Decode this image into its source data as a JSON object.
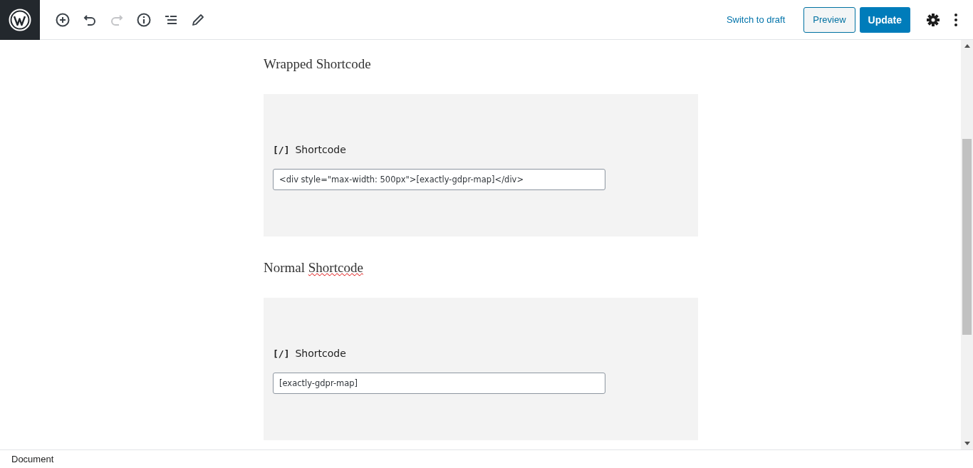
{
  "toolbar": {
    "tools": [
      {
        "kind": "add",
        "disabled": false
      },
      {
        "kind": "undo",
        "disabled": false
      },
      {
        "kind": "redo",
        "disabled": true
      },
      {
        "kind": "info",
        "disabled": false
      },
      {
        "kind": "outline",
        "disabled": false
      },
      {
        "kind": "edit",
        "disabled": false
      }
    ],
    "switch_link": "Switch to draft",
    "preview_button": "Preview",
    "update_button": "Update"
  },
  "sections": [
    {
      "heading": [
        {
          "text": "Wrapped",
          "misspelled": false
        },
        {
          "text": "Shortcode",
          "misspelled": false
        }
      ],
      "block": {
        "icon": "[/]",
        "label": "Shortcode",
        "value": "<div style=\"max-width: 500px\">[exactly-gdpr-map]</div>"
      }
    },
    {
      "heading": [
        {
          "text": "Normal",
          "misspelled": false
        },
        {
          "text": "Shortcode",
          "misspelled": true
        }
      ],
      "block": {
        "icon": "[/]",
        "label": "Shortcode",
        "value": "[exactly-gdpr-map]"
      }
    }
  ],
  "status_bar": "Document"
}
